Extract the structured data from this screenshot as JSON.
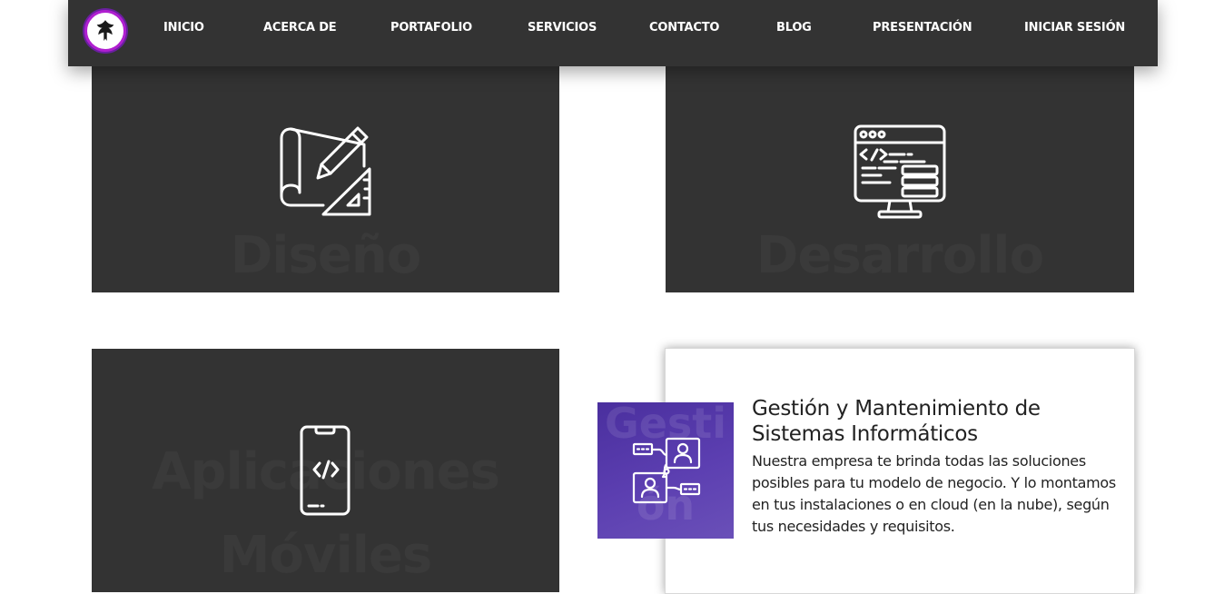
{
  "nav": {
    "items": [
      {
        "label": "INICIO"
      },
      {
        "label": "ACERCA DE"
      },
      {
        "label": "PORTAFOLIO"
      },
      {
        "label": "SERVICIOS"
      },
      {
        "label": "CONTACTO"
      },
      {
        "label": "BLOG"
      },
      {
        "label": "PRESENTACIÓN"
      },
      {
        "label": "INICIAR SESIÓN"
      }
    ]
  },
  "cards": {
    "diseno": {
      "watermark": "Diseño",
      "icon": "blueprint-pencil-ruler-icon"
    },
    "desarrollo": {
      "watermark": "Desarrollo",
      "icon": "code-monitor-icon"
    },
    "aplicaciones": {
      "watermark_line1": "Aplicaciones",
      "watermark_line2": "Móviles",
      "icon": "smartphone-code-icon"
    },
    "gestion": {
      "watermark_line1": "Gesti",
      "watermark_line2": "ón",
      "icon": "network-users-icon",
      "title": "Gestión y Mantenimiento de Sistemas Informáticos",
      "description": "Nuestra empresa te brinda todas las soluciones posibles para tu modelo de negocio. Y lo montamos en tus instalaciones o en cloud (en la nube), según tus necesidades y requisitos."
    }
  },
  "colors": {
    "navbar": "#333333",
    "card_dark": "#333333",
    "accent_purple": "#5c3fb1",
    "logo_ring": "#b01fd0"
  }
}
